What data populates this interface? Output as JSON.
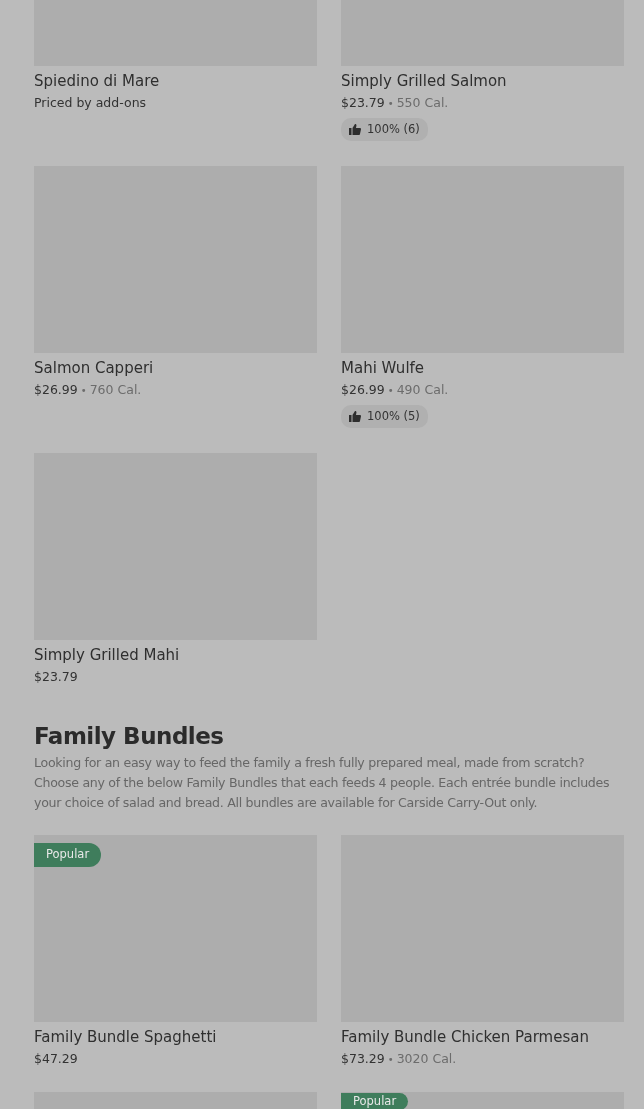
{
  "sections": [
    {
      "items": [
        {
          "kind": "picture",
          "name": "Spiedino di Mare",
          "price": "Priced by add-ons"
        },
        {
          "kind": "picture",
          "name": "Simply Grilled Salmon",
          "price": "$23.79",
          "separator": "•",
          "calories": "550 Cal.",
          "rating": "100% (6)"
        },
        {
          "kind": "picture",
          "name": "Salmon Capperi",
          "price": "$26.99",
          "separator": "•",
          "calories": "760 Cal."
        },
        {
          "kind": "picture",
          "name": "Mahi Wulfe",
          "price": "$26.99",
          "separator": "•",
          "calories": "490 Cal.",
          "rating": "100% (5)"
        },
        {
          "kind": "picture",
          "name": "Simply Grilled Mahi",
          "price": "$23.79"
        }
      ]
    },
    {
      "title": "Family Bundles",
      "description": "Looking for an easy way to feed the family a fresh fully prepared meal, made from scratch? Choose any of the below Family Bundles that each feeds 4 people. Each entrée bundle includes your choice of salad and bread. All bundles are available for Carside Carry-Out only.",
      "items": [
        {
          "kind": "picture",
          "name": "Family Bundle Spaghetti",
          "price": "$47.29",
          "badge": "Popular"
        },
        {
          "kind": "picture",
          "name": "Family Bundle Chicken Parmesan",
          "price": "$73.29",
          "separator": "•",
          "calories": "3020 Cal."
        },
        {
          "kind": "picture"
        },
        {
          "kind": "picture",
          "badge": "Popular"
        }
      ]
    }
  ]
}
